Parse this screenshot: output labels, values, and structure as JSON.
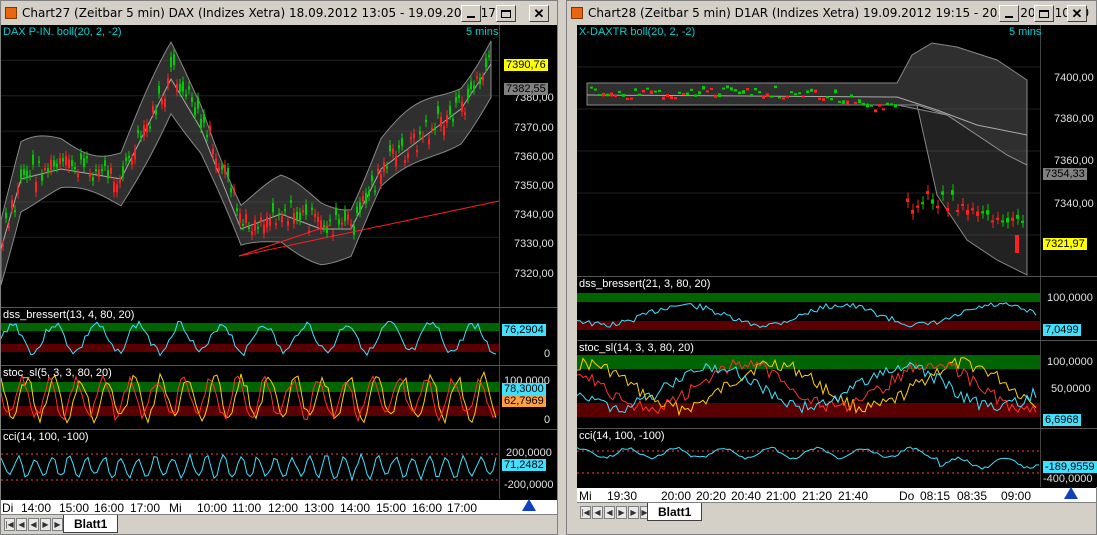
{
  "window1": {
    "title": "Chart27 (Zeitbar 5 min)  DAX (Indizes Xetra) 18.09.2012 13:05 - 19.09.2012 17:55",
    "interval": "5 mins",
    "main": {
      "label": "DAX P-IN. boll(20, 2, -2)",
      "ticks": [
        "7380,00",
        "7370,00",
        "7360,00",
        "7350,00",
        "7340,00",
        "7330,00",
        "7320,00"
      ],
      "price_last": "7390,76",
      "price_band": "7382,55"
    },
    "dss": {
      "label": "dss_bressert(13, 4, 80, 20)",
      "value": "76,2904",
      "zero": "0"
    },
    "stoc": {
      "label": "stoc_sl(5, 3, 3, 80, 20)",
      "value_a": "78,3000",
      "value_b": "62,7969",
      "top": "100,0000",
      "zero": "0"
    },
    "cci": {
      "label": "cci(14, 100, -100)",
      "top": "200,0000",
      "value": "71,2482",
      "bottom": "-200,0000"
    },
    "xaxis": [
      "Di",
      "14:00",
      "15:00",
      "16:00",
      "17:00",
      "Mi",
      "10:00",
      "11:00",
      "12:00",
      "13:00",
      "14:00",
      "15:00",
      "16:00",
      "17:00"
    ],
    "sheet_tab": "Blatt1"
  },
  "window2": {
    "title": "Chart28 (Zeitbar 5 min)  D1AR (Indizes Xetra) 19.09.2012 19:15 - 20.09.2012 10:00",
    "interval": "5 mins",
    "main": {
      "label": "X-DAXTR  boll(20, 2, -2)",
      "ticks": [
        "7400,00",
        "7380,00",
        "7360,00",
        "7340,00"
      ],
      "band_value": "7354,33",
      "price_last": "7321,97"
    },
    "dss": {
      "label": "dss_bressert(21, 3, 80, 20)",
      "top": "100,0000",
      "value": "7,0499"
    },
    "stoc": {
      "label": "stoc_sl(14, 3, 3, 80, 20)",
      "top": "100,0000",
      "mid": "50,0000",
      "value": "6,6968"
    },
    "cci": {
      "label": "cci(14, 100, -100)",
      "value": "-189,9559",
      "bottom": "-400,0000"
    },
    "xaxis": [
      "Mi",
      "19:30",
      "20:00",
      "20:20",
      "20:40",
      "21:00",
      "21:20",
      "21:40",
      "Do",
      "08:15",
      "08:35",
      "09:00"
    ],
    "sheet_tab": "Blatt1"
  },
  "colors": {
    "bull": "#00cc00",
    "bear": "#ff2020",
    "band": "#555555",
    "dss_line": "#40e0ff",
    "stoc_k": "#ffd000",
    "stoc_d": "#ff3030",
    "zone_green": "#006400",
    "zone_red": "#5a0000"
  }
}
